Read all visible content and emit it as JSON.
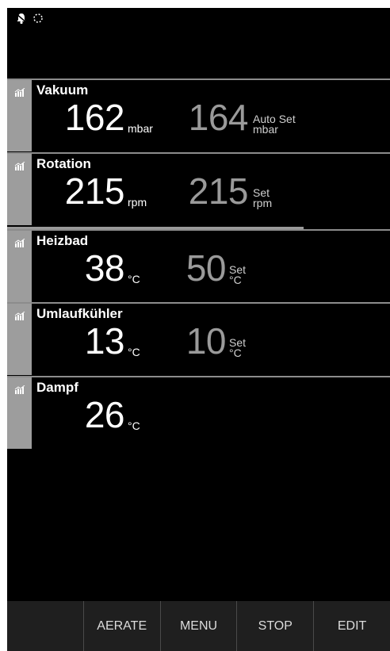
{
  "status": {
    "icons": [
      "bell-icon",
      "loading-spinner-icon"
    ]
  },
  "panels": [
    {
      "label": "Vakuum",
      "value": "162",
      "unit": "mbar",
      "set_value": "164",
      "set_label_1": "Auto Set",
      "set_label_2": "mbar"
    },
    {
      "label": "Rotation",
      "value": "215",
      "unit": "rpm",
      "set_value": "215",
      "set_label_1": "Set",
      "set_label_2": "rpm"
    },
    {
      "label": "Heizbad",
      "value": "38",
      "unit": "°C",
      "set_value": "50",
      "set_label_1": "Set",
      "set_label_2": "°C"
    },
    {
      "label": "Umlaufkühler",
      "value": "13",
      "unit": "°C",
      "set_value": "10",
      "set_label_1": "Set",
      "set_label_2": "°C"
    },
    {
      "label": "Dampf",
      "value": "26",
      "unit": "°C"
    }
  ],
  "buttons": [
    "",
    "AERATE",
    "MENU",
    "STOP",
    "EDIT"
  ],
  "colors": {
    "background": "#000000",
    "tab": "#9d9d9d",
    "set_value": "#9a9a9a",
    "button_bar": "#1f1f1f"
  }
}
